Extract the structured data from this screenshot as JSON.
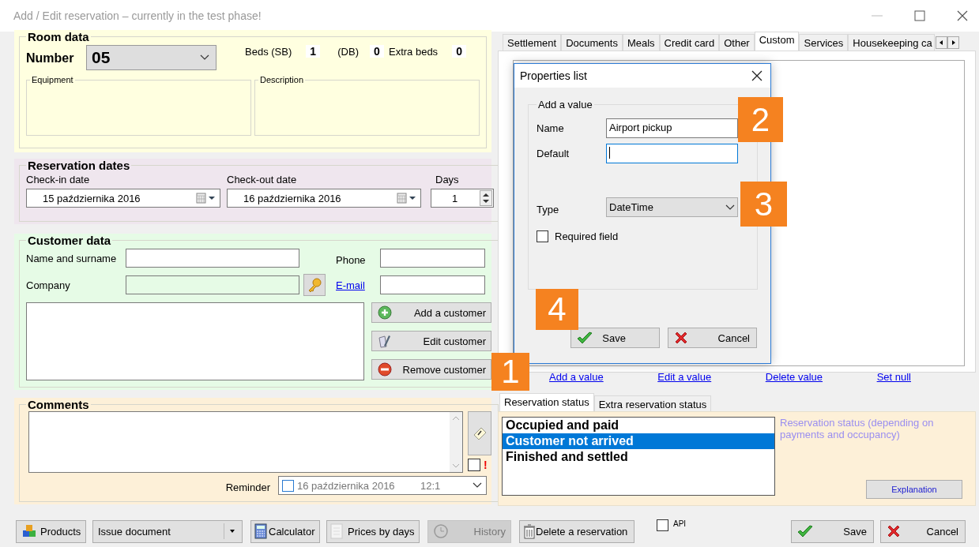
{
  "window": {
    "title": "Add / Edit reservation – currently in the test phase!"
  },
  "room": {
    "title": "Room data",
    "number_label": "Number",
    "number": "05",
    "beds_sb_label": "Beds (SB)",
    "beds_sb": "1",
    "db_label": "(DB)",
    "db": "0",
    "extra_label": "Extra beds",
    "extra": "0",
    "equipment_label": "Equipment",
    "description_label": "Description"
  },
  "dates": {
    "title": "Reservation dates",
    "checkin_label": "Check-in date",
    "checkin": "15 października 2016",
    "checkout_label": "Check-out date",
    "checkout": "16 października 2016",
    "days_label": "Days",
    "days": "1"
  },
  "customer": {
    "title": "Customer data",
    "name_label": "Name and surname",
    "company_label": "Company",
    "phone_label": "Phone",
    "email_link": "E-mail",
    "buttons": [
      {
        "kind": "add",
        "label": "Add a customer"
      },
      {
        "kind": "edit",
        "label": "Edit customer"
      },
      {
        "kind": "remove",
        "label": "Remove customer"
      }
    ]
  },
  "comments": {
    "title": "Comments",
    "flag_checked": false,
    "alert_mark": "!",
    "reminder_label": "Reminder",
    "reminder_checked": false,
    "reminder_date": "16 października 2016",
    "reminder_time": "12:1"
  },
  "tabs": [
    {
      "label": "Settlement",
      "selected": false
    },
    {
      "label": "Documents",
      "selected": false
    },
    {
      "label": "Meals",
      "selected": false
    },
    {
      "label": "Credit card",
      "selected": false
    },
    {
      "label": "Other",
      "selected": false
    },
    {
      "label": "Custom",
      "selected": true
    },
    {
      "label": "Services",
      "selected": false
    },
    {
      "label": "Housekeeping ca",
      "selected": false
    }
  ],
  "links": [
    "Add a value",
    "Edit a value",
    "Delete value",
    "Set null"
  ],
  "dialog": {
    "title": "Properties list",
    "group_title": "Add a value",
    "name_label": "Name",
    "name_value": "Airport pickup",
    "default_label": "Default",
    "type_label": "Type",
    "type_value": "DateTime",
    "required_label": "Required field",
    "required_checked": false,
    "buttons": [
      {
        "kind": "save",
        "label": "Save"
      },
      {
        "kind": "cancel",
        "label": "Cancel"
      }
    ]
  },
  "callouts": [
    "1",
    "2",
    "3",
    "4"
  ],
  "status_tabs": [
    {
      "label": "Reservation status",
      "selected": true
    },
    {
      "label": "Extra reservation status",
      "selected": false
    }
  ],
  "status_list": [
    {
      "label": "Occupied and paid",
      "selected": false
    },
    {
      "label": "Customer not arrived",
      "selected": true
    },
    {
      "label": "Finished and settled",
      "selected": false
    }
  ],
  "status_hint": "Reservation status (depending on payments and occupancy)",
  "explanation_button": "Explanation",
  "toolbar": {
    "products": "Products",
    "issue_document": "Issue document",
    "calculator": "Calculator",
    "prices_by_days": "Prices by days",
    "history": {
      "label": "History",
      "disabled": true
    },
    "delete": "Delete a reservation",
    "api": {
      "label": "API",
      "checked": false
    },
    "save": "Save",
    "cancel": "Cancel"
  }
}
